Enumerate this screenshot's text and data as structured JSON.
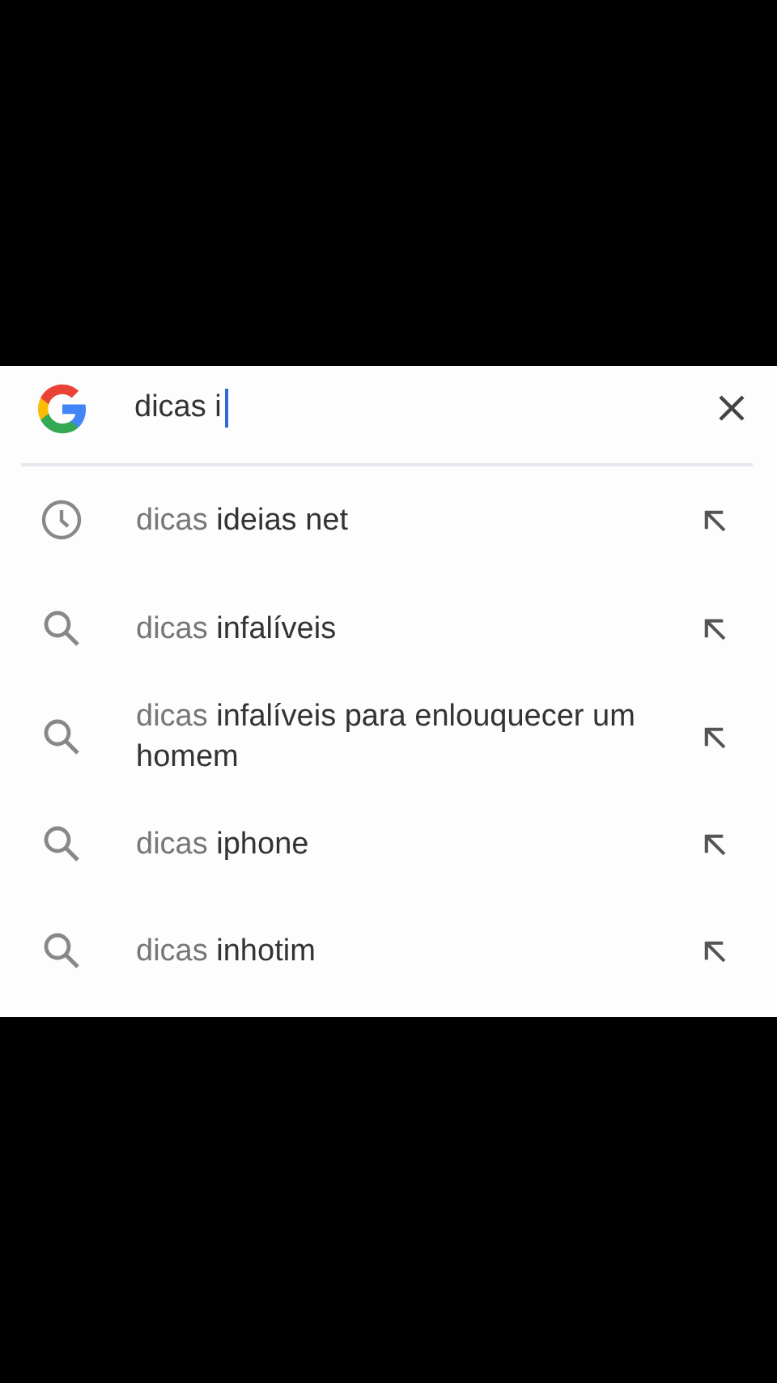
{
  "search": {
    "value": "dicas i"
  },
  "suggestions": [
    {
      "kind": "history",
      "text": "dicas **ideias net**"
    },
    {
      "kind": "search",
      "text": "dicas **infalíveis**"
    },
    {
      "kind": "search",
      "text": "dicas **infalíveis para enlouquecer um homem**"
    },
    {
      "kind": "search",
      "text": "dicas **iphone**"
    },
    {
      "kind": "search",
      "text": "dicas **inhotim**"
    }
  ]
}
